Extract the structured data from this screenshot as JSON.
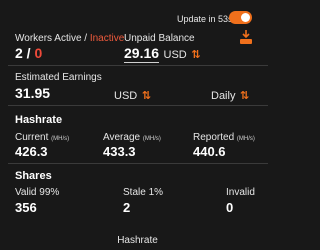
{
  "header": {
    "update_label": "Update in 53s",
    "toggle_on": true
  },
  "workers": {
    "label_active": "Workers Active",
    "label_sep": " / ",
    "label_inactive": "Inactive",
    "active": "2",
    "sep": " / ",
    "inactive": "0"
  },
  "balance": {
    "label": "Unpaid Balance",
    "value": "29.16",
    "unit": "USD",
    "swap_icon": "swap-arrows-icon"
  },
  "earnings": {
    "label": "Estimated Earnings",
    "value": "31.95",
    "unit": "USD",
    "period": "Daily",
    "swap_icon": "swap-arrows-icon"
  },
  "hashrate": {
    "title": "Hashrate",
    "unit": "(MH/s)",
    "current_label": "Current",
    "current_value": "426.3",
    "average_label": "Average",
    "average_value": "433.3",
    "reported_label": "Reported",
    "reported_value": "440.6"
  },
  "shares": {
    "title": "Shares",
    "valid_label": "Valid 99%",
    "valid_value": "356",
    "stale_label": "Stale 1%",
    "stale_value": "2",
    "invalid_label": "Invalid",
    "invalid_value": "0"
  },
  "footer": {
    "title": "Hashrate"
  },
  "colors": {
    "accent": "#f0701c",
    "inactive": "#ef4a3a",
    "background": "#181818"
  }
}
